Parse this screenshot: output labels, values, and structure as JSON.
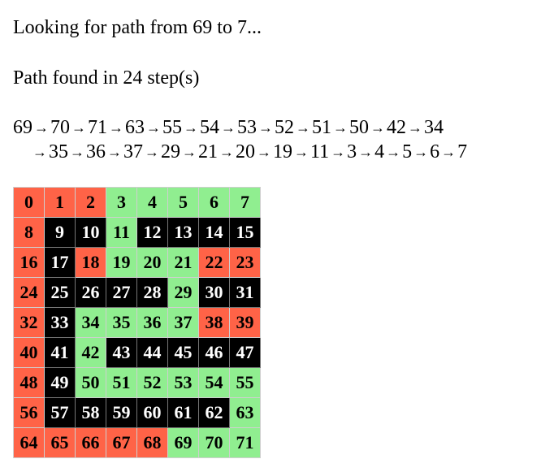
{
  "status": "Looking for path from 69 to 7...",
  "result": "Path found in 24 step(s)",
  "path_line_1": [
    "69",
    "70",
    "71",
    "63",
    "55",
    "54",
    "53",
    "52",
    "51",
    "50",
    "42",
    "34"
  ],
  "path_line_2": [
    "35",
    "36",
    "37",
    "29",
    "21",
    "20",
    "19",
    "11",
    "3",
    "4",
    "5",
    "6",
    "7"
  ],
  "arrow": "→",
  "colors": {
    "path": "#90ee90",
    "wall": "#000000",
    "open": "#ff6347"
  },
  "grid": [
    [
      {
        "v": "0",
        "s": "open"
      },
      {
        "v": "1",
        "s": "open"
      },
      {
        "v": "2",
        "s": "open"
      },
      {
        "v": "3",
        "s": "path"
      },
      {
        "v": "4",
        "s": "path"
      },
      {
        "v": "5",
        "s": "path"
      },
      {
        "v": "6",
        "s": "path"
      },
      {
        "v": "7",
        "s": "path"
      }
    ],
    [
      {
        "v": "8",
        "s": "open"
      },
      {
        "v": "9",
        "s": "wall"
      },
      {
        "v": "10",
        "s": "wall"
      },
      {
        "v": "11",
        "s": "path"
      },
      {
        "v": "12",
        "s": "wall"
      },
      {
        "v": "13",
        "s": "wall"
      },
      {
        "v": "14",
        "s": "wall"
      },
      {
        "v": "15",
        "s": "wall"
      }
    ],
    [
      {
        "v": "16",
        "s": "open"
      },
      {
        "v": "17",
        "s": "wall"
      },
      {
        "v": "18",
        "s": "open"
      },
      {
        "v": "19",
        "s": "path"
      },
      {
        "v": "20",
        "s": "path"
      },
      {
        "v": "21",
        "s": "path"
      },
      {
        "v": "22",
        "s": "open"
      },
      {
        "v": "23",
        "s": "open"
      }
    ],
    [
      {
        "v": "24",
        "s": "open"
      },
      {
        "v": "25",
        "s": "wall"
      },
      {
        "v": "26",
        "s": "wall"
      },
      {
        "v": "27",
        "s": "wall"
      },
      {
        "v": "28",
        "s": "wall"
      },
      {
        "v": "29",
        "s": "path"
      },
      {
        "v": "30",
        "s": "wall"
      },
      {
        "v": "31",
        "s": "wall"
      }
    ],
    [
      {
        "v": "32",
        "s": "open"
      },
      {
        "v": "33",
        "s": "wall"
      },
      {
        "v": "34",
        "s": "path"
      },
      {
        "v": "35",
        "s": "path"
      },
      {
        "v": "36",
        "s": "path"
      },
      {
        "v": "37",
        "s": "path"
      },
      {
        "v": "38",
        "s": "open"
      },
      {
        "v": "39",
        "s": "open"
      }
    ],
    [
      {
        "v": "40",
        "s": "open"
      },
      {
        "v": "41",
        "s": "wall"
      },
      {
        "v": "42",
        "s": "path"
      },
      {
        "v": "43",
        "s": "wall"
      },
      {
        "v": "44",
        "s": "wall"
      },
      {
        "v": "45",
        "s": "wall"
      },
      {
        "v": "46",
        "s": "wall"
      },
      {
        "v": "47",
        "s": "wall"
      }
    ],
    [
      {
        "v": "48",
        "s": "open"
      },
      {
        "v": "49",
        "s": "wall"
      },
      {
        "v": "50",
        "s": "path"
      },
      {
        "v": "51",
        "s": "path"
      },
      {
        "v": "52",
        "s": "path"
      },
      {
        "v": "53",
        "s": "path"
      },
      {
        "v": "54",
        "s": "path"
      },
      {
        "v": "55",
        "s": "path"
      }
    ],
    [
      {
        "v": "56",
        "s": "open"
      },
      {
        "v": "57",
        "s": "wall"
      },
      {
        "v": "58",
        "s": "wall"
      },
      {
        "v": "59",
        "s": "wall"
      },
      {
        "v": "60",
        "s": "wall"
      },
      {
        "v": "61",
        "s": "wall"
      },
      {
        "v": "62",
        "s": "wall"
      },
      {
        "v": "63",
        "s": "path"
      }
    ],
    [
      {
        "v": "64",
        "s": "open"
      },
      {
        "v": "65",
        "s": "open"
      },
      {
        "v": "66",
        "s": "open"
      },
      {
        "v": "67",
        "s": "open"
      },
      {
        "v": "68",
        "s": "open"
      },
      {
        "v": "69",
        "s": "path"
      },
      {
        "v": "70",
        "s": "path"
      },
      {
        "v": "71",
        "s": "path"
      }
    ]
  ]
}
